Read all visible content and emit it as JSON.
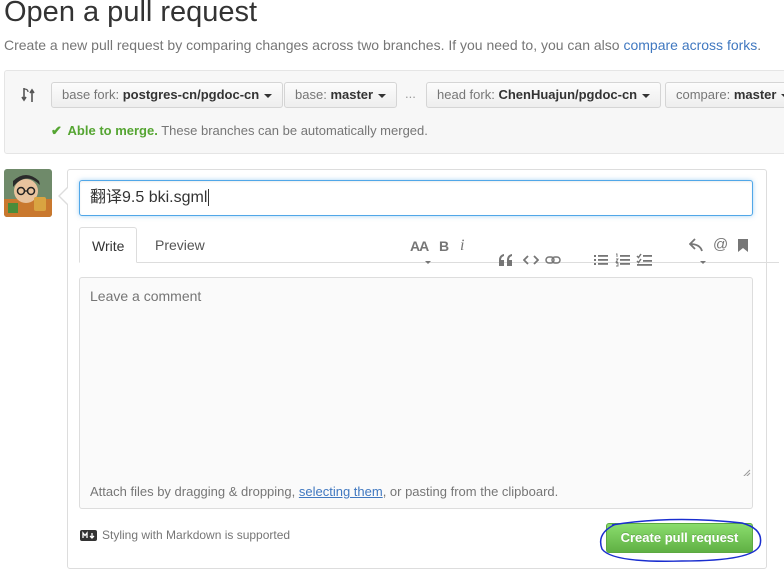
{
  "page": {
    "title": "Open a pull request",
    "description": "Create a new pull request by comparing changes across two branches. If you need to, you can also ",
    "description_link": "compare across forks",
    "description_end": "."
  },
  "range": {
    "base_fork_prefix": "base fork:",
    "base_fork": "postgres-cn/pgdoc-cn",
    "base_prefix": "base:",
    "base": "master",
    "ellipsis": "...",
    "head_fork_prefix": "head fork:",
    "head_fork": "ChenHuajun/pgdoc-cn",
    "compare_prefix": "compare:",
    "compare": "master",
    "merge_ok": "Able to merge.",
    "merge_text": "These branches can be automatically merged."
  },
  "form": {
    "title_value": "翻译9.5 bki.sgml",
    "tabs": [
      "Write",
      "Preview"
    ],
    "toolbar": {
      "header": "AA",
      "bold": "B",
      "italic": "i",
      "mention": "@"
    },
    "comment_placeholder": "Leave a comment",
    "attach_pre": "Attach files by dragging & dropping, ",
    "attach_link": "selecting them",
    "attach_post": ", or pasting from the clipboard.",
    "markdown_note": "Styling with Markdown is supported",
    "submit_label": "Create pull request"
  },
  "colors": {
    "accent_link": "#4078c0",
    "success": "#55a532",
    "button_green": "#60b044",
    "annotation": "#1a2ecf"
  }
}
